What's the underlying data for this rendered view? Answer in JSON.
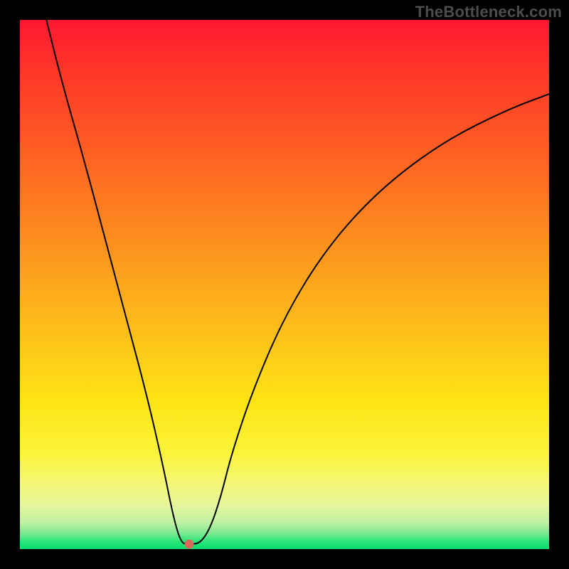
{
  "watermark": "TheBottleneck.com",
  "chart_data": {
    "type": "line",
    "title": "",
    "xlabel": "",
    "ylabel": "",
    "xlim": [
      0,
      100
    ],
    "ylim": [
      0,
      100
    ],
    "grid": false,
    "legend": false,
    "background_gradient": {
      "direction": "vertical",
      "stops": [
        {
          "pos": 0,
          "color": "#ff1730"
        },
        {
          "pos": 22,
          "color": "#fe5724"
        },
        {
          "pos": 40,
          "color": "#fd8a1f"
        },
        {
          "pos": 58,
          "color": "#fdbd1a"
        },
        {
          "pos": 72,
          "color": "#fde414"
        },
        {
          "pos": 88,
          "color": "#f3f77a"
        },
        {
          "pos": 95,
          "color": "#bef1a2"
        },
        {
          "pos": 100,
          "color": "#06e06d"
        }
      ]
    },
    "series": [
      {
        "name": "bottleneck-curve",
        "x": [
          5,
          8,
          12,
          16,
          20,
          24,
          27,
          29,
          30.5,
          32,
          34,
          36,
          38,
          40,
          44,
          50,
          58,
          68,
          80,
          92,
          100
        ],
        "y": [
          100,
          88,
          74,
          59,
          44,
          29,
          16,
          6,
          1,
          1,
          1,
          4,
          10,
          18,
          30,
          44,
          57,
          68,
          77,
          83,
          86
        ]
      }
    ],
    "marker": {
      "x": 32,
      "y": 1,
      "color": "#d9685b"
    }
  }
}
